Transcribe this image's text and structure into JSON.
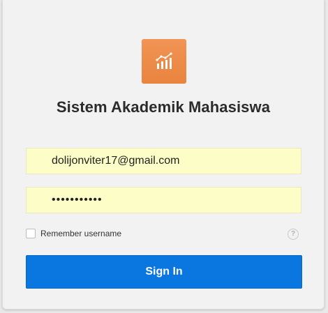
{
  "app": {
    "title": "Sistem Akademik Mahasiswa",
    "logo_icon": "chart-growth-icon",
    "logo_color": "#ef8c49"
  },
  "form": {
    "username_value": "dolijonviter17@gmail.com",
    "password_mask": "•••••••••••",
    "remember_label": "Remember username",
    "remember_checked": false,
    "help_glyph": "?",
    "signin_label": "Sign In"
  },
  "colors": {
    "primary": "#0a76e0",
    "autofill_bg": "#fdfdc7"
  }
}
